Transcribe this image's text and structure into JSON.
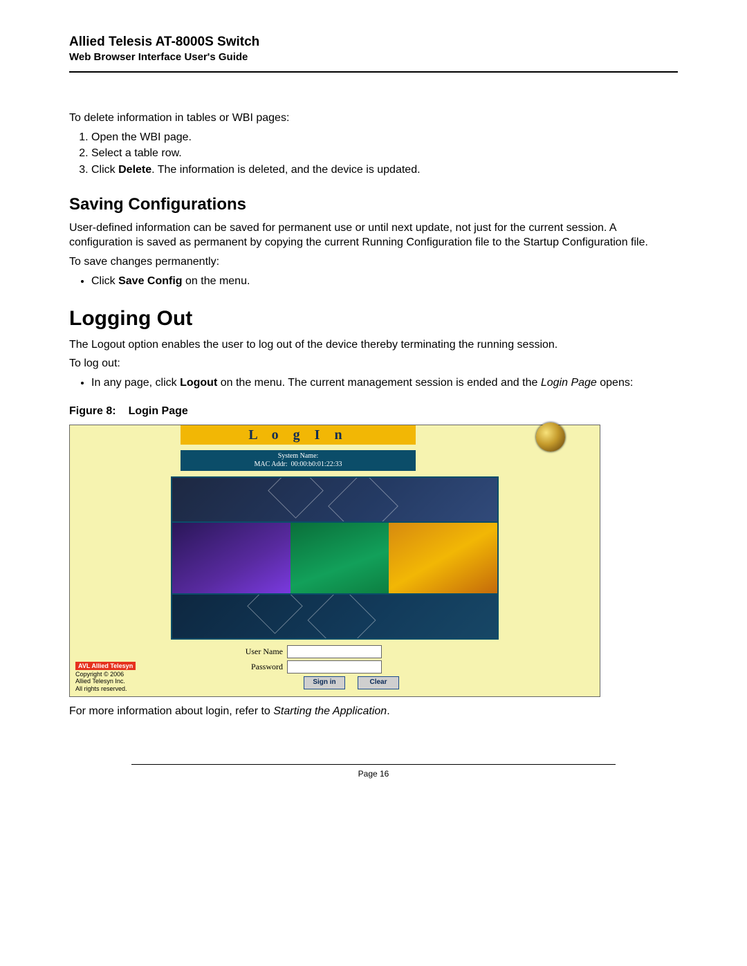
{
  "header": {
    "title": "Allied Telesis AT-8000S Switch",
    "subtitle": "Web Browser Interface User's Guide"
  },
  "intro": {
    "lead": "To delete information in tables or WBI pages:",
    "steps": {
      "s1": "Open the WBI page.",
      "s2": "Select a table row.",
      "s3_pre": "Click ",
      "s3_bold": "Delete",
      "s3_post": ". The information is deleted, and the device is updated."
    }
  },
  "saving": {
    "heading": "Saving Configurations",
    "p1": "User-defined information can be saved for permanent use or until next update, not just for the current session. A configuration is saved as permanent by copying the current Running Configuration file to the Startup Configuration file.",
    "lead": "To save changes permanently:",
    "bullet_pre": "Click ",
    "bullet_bold": "Save Config",
    "bullet_post": " on the menu."
  },
  "logout": {
    "heading": "Logging Out",
    "p1": "The Logout option enables the user to log out of the device thereby terminating the running session.",
    "lead": "To log out:",
    "bullet_pre": "In any page, click ",
    "bullet_bold": "Logout",
    "bullet_mid": " on the menu. The current management session is ended and the ",
    "bullet_it": "Login Page",
    "bullet_post": " opens:"
  },
  "figure": {
    "caption_label": "Figure 8:",
    "caption_title": "Login Page"
  },
  "login_ui": {
    "title": "L o g   I n",
    "sysname_label": "System Name:",
    "sysname_value": "",
    "mac_label": "MAC Addr:",
    "mac_value": "00:00:b0:01:22:33",
    "username_label": "User Name",
    "password_label": "Password",
    "signin_btn": "Sign in",
    "clear_btn": "Clear",
    "brand": "AVL Allied Telesyn",
    "copyright": "Copyright © 2006\nAllied Telesyn Inc.\nAll rights reserved."
  },
  "after_fig": {
    "pre": "For more information about login, refer to ",
    "it": "Starting the Application",
    "post": "."
  },
  "footer": {
    "page": "Page 16"
  }
}
